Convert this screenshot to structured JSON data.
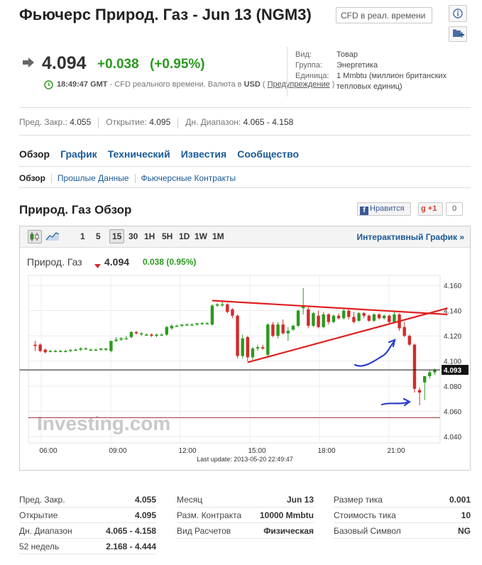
{
  "header": {
    "title": "Фьючерс Природ. Газ - Jun 13 (NGM3)",
    "cfd_placeholder": "CFD в реал. времени"
  },
  "quote": {
    "price": "4.094",
    "change": "+0.038",
    "change_pct": "(+0.95%)",
    "time": "18:49:47 GMT",
    "desc": " - CFD реального времени. Валюта в ",
    "currency": "USD",
    "paren_open": " ( ",
    "warning_link": "Предупреждение",
    "paren_close": " )"
  },
  "facts": [
    {
      "label": "Вид:",
      "value": "Товар"
    },
    {
      "label": "Группа:",
      "value": "Энергетика"
    },
    {
      "label": "Единица:",
      "value": "1 Mmbtu (миллион британских"
    },
    {
      "label": "",
      "value": "тепловых единиц)"
    }
  ],
  "stats": [
    {
      "label": "Пред. Закр.:",
      "value": "4.055"
    },
    {
      "label": "Открытие:",
      "value": "4.095"
    },
    {
      "label": "Дн. Диапазон:",
      "value": "4.065 - 4.158"
    }
  ],
  "tabs": [
    "Обзор",
    "График",
    "Технический",
    "Известия",
    "Сообщество"
  ],
  "subtabs": [
    "Обзор",
    "Прошлые Данные",
    "Фьючерсные Контракты"
  ],
  "section": {
    "title": "Природ. Газ Обзор",
    "like_label": "Нравится",
    "gplus_label": "+1",
    "gplus_count": "0"
  },
  "chart_toolbar": {
    "timeframes": [
      "1",
      "5",
      "15",
      "30",
      "1H",
      "5H",
      "1D",
      "1W",
      "1M"
    ],
    "selected": "15",
    "interactive_label": "Интерактивный График »"
  },
  "chart_header": {
    "name": "Природ. Газ",
    "price": "4.094",
    "change": "0.038 (0.95%)"
  },
  "chart_data": {
    "type": "candlestick",
    "x_ticks": [
      "06:00",
      "09:00",
      "12:00",
      "15:00",
      "18:00",
      "21:00"
    ],
    "y_ticks": [
      "4.160",
      "4.140",
      "4.120",
      "4.100",
      "4.080",
      "4.060",
      "4.040"
    ],
    "ylim": [
      4.035,
      4.168
    ],
    "current_price_label": "4.093",
    "current_price": 4.093,
    "prev_close": 4.055,
    "last_update": "Last update: 2013-05-20 22:49:47",
    "watermark": "Investing.com",
    "candles": [
      {
        "o": 4.113,
        "h": 4.116,
        "l": 4.108,
        "c": 4.112
      },
      {
        "o": 4.113,
        "h": 4.114,
        "l": 4.107,
        "c": 4.108
      },
      {
        "o": 4.109,
        "h": 4.11,
        "l": 4.106,
        "c": 4.107
      },
      {
        "o": 4.108,
        "h": 4.109,
        "l": 4.107,
        "c": 4.108
      },
      {
        "o": 4.108,
        "h": 4.109,
        "l": 4.107,
        "c": 4.108
      },
      {
        "o": 4.108,
        "h": 4.109,
        "l": 4.107,
        "c": 4.108
      },
      {
        "o": 4.108,
        "h": 4.109,
        "l": 4.107,
        "c": 4.108
      },
      {
        "o": 4.108,
        "h": 4.109,
        "l": 4.107,
        "c": 4.109
      },
      {
        "o": 4.109,
        "h": 4.11,
        "l": 4.108,
        "c": 4.109
      },
      {
        "o": 4.109,
        "h": 4.111,
        "l": 4.108,
        "c": 4.11
      },
      {
        "o": 4.11,
        "h": 4.111,
        "l": 4.109,
        "c": 4.11
      },
      {
        "o": 4.109,
        "h": 4.11,
        "l": 4.108,
        "c": 4.109
      },
      {
        "o": 4.109,
        "h": 4.11,
        "l": 4.108,
        "c": 4.109
      },
      {
        "o": 4.109,
        "h": 4.11,
        "l": 4.108,
        "c": 4.11
      },
      {
        "o": 4.109,
        "h": 4.11,
        "l": 4.108,
        "c": 4.11
      },
      {
        "o": 4.108,
        "h": 4.116,
        "l": 4.107,
        "c": 4.116
      },
      {
        "o": 4.116,
        "h": 4.119,
        "l": 4.115,
        "c": 4.117
      },
      {
        "o": 4.117,
        "h": 4.119,
        "l": 4.116,
        "c": 4.118
      },
      {
        "o": 4.118,
        "h": 4.12,
        "l": 4.117,
        "c": 4.118
      },
      {
        "o": 4.119,
        "h": 4.124,
        "l": 4.118,
        "c": 4.123
      },
      {
        "o": 4.123,
        "h": 4.124,
        "l": 4.121,
        "c": 4.122
      },
      {
        "o": 4.122,
        "h": 4.123,
        "l": 4.12,
        "c": 4.122
      },
      {
        "o": 4.121,
        "h": 4.122,
        "l": 4.12,
        "c": 4.121
      },
      {
        "o": 4.121,
        "h": 4.122,
        "l": 4.119,
        "c": 4.12
      },
      {
        "o": 4.12,
        "h": 4.122,
        "l": 4.119,
        "c": 4.121
      },
      {
        "o": 4.121,
        "h": 4.122,
        "l": 4.12,
        "c": 4.121
      },
      {
        "o": 4.121,
        "h": 4.128,
        "l": 4.12,
        "c": 4.127
      },
      {
        "o": 4.126,
        "h": 4.129,
        "l": 4.125,
        "c": 4.128
      },
      {
        "o": 4.128,
        "h": 4.129,
        "l": 4.127,
        "c": 4.128
      },
      {
        "o": 4.128,
        "h": 4.129,
        "l": 4.127,
        "c": 4.129
      },
      {
        "o": 4.129,
        "h": 4.13,
        "l": 4.128,
        "c": 4.129
      },
      {
        "o": 4.129,
        "h": 4.13,
        "l": 4.128,
        "c": 4.129
      },
      {
        "o": 4.129,
        "h": 4.13,
        "l": 4.128,
        "c": 4.13
      },
      {
        "o": 4.13,
        "h": 4.131,
        "l": 4.129,
        "c": 4.13
      },
      {
        "o": 4.13,
        "h": 4.131,
        "l": 4.129,
        "c": 4.13
      },
      {
        "o": 4.129,
        "h": 4.145,
        "l": 4.128,
        "c": 4.144
      },
      {
        "o": 4.144,
        "h": 4.146,
        "l": 4.143,
        "c": 4.145
      },
      {
        "o": 4.145,
        "h": 4.147,
        "l": 4.143,
        "c": 4.145
      },
      {
        "o": 4.145,
        "h": 4.146,
        "l": 4.138,
        "c": 4.139
      },
      {
        "o": 4.141,
        "h": 4.142,
        "l": 4.134,
        "c": 4.136
      },
      {
        "o": 4.136,
        "h": 4.137,
        "l": 4.102,
        "c": 4.104
      },
      {
        "o": 4.104,
        "h": 4.121,
        "l": 4.102,
        "c": 4.118
      },
      {
        "o": 4.119,
        "h": 4.12,
        "l": 4.1,
        "c": 4.103
      },
      {
        "o": 4.103,
        "h": 4.111,
        "l": 4.101,
        "c": 4.11
      },
      {
        "o": 4.11,
        "h": 4.113,
        "l": 4.108,
        "c": 4.111
      },
      {
        "o": 4.111,
        "h": 4.113,
        "l": 4.109,
        "c": 4.11
      },
      {
        "o": 4.105,
        "h": 4.13,
        "l": 4.104,
        "c": 4.129
      },
      {
        "o": 4.129,
        "h": 4.131,
        "l": 4.119,
        "c": 4.12
      },
      {
        "o": 4.12,
        "h": 4.131,
        "l": 4.118,
        "c": 4.129
      },
      {
        "o": 4.129,
        "h": 4.133,
        "l": 4.121,
        "c": 4.122
      },
      {
        "o": 4.122,
        "h": 4.127,
        "l": 4.116,
        "c": 4.124
      },
      {
        "o": 4.125,
        "h": 4.129,
        "l": 4.124,
        "c": 4.128
      },
      {
        "o": 4.128,
        "h": 4.141,
        "l": 4.127,
        "c": 4.14
      },
      {
        "o": 4.142,
        "h": 4.158,
        "l": 4.137,
        "c": 4.144
      },
      {
        "o": 4.141,
        "h": 4.144,
        "l": 4.126,
        "c": 4.128
      },
      {
        "o": 4.128,
        "h": 4.139,
        "l": 4.127,
        "c": 4.138
      },
      {
        "o": 4.136,
        "h": 4.14,
        "l": 4.126,
        "c": 4.127
      },
      {
        "o": 4.127,
        "h": 4.139,
        "l": 4.126,
        "c": 4.137
      },
      {
        "o": 4.137,
        "h": 4.138,
        "l": 4.129,
        "c": 4.131
      },
      {
        "o": 4.131,
        "h": 4.137,
        "l": 4.13,
        "c": 4.136
      },
      {
        "o": 4.136,
        "h": 4.138,
        "l": 4.133,
        "c": 4.134
      },
      {
        "o": 4.134,
        "h": 4.141,
        "l": 4.133,
        "c": 4.14
      },
      {
        "o": 4.14,
        "h": 4.141,
        "l": 4.133,
        "c": 4.135
      },
      {
        "o": 4.135,
        "h": 4.139,
        "l": 4.13,
        "c": 4.131
      },
      {
        "o": 4.132,
        "h": 4.139,
        "l": 4.131,
        "c": 4.138
      },
      {
        "o": 4.138,
        "h": 4.139,
        "l": 4.134,
        "c": 4.136
      },
      {
        "o": 4.136,
        "h": 4.137,
        "l": 4.131,
        "c": 4.132
      },
      {
        "o": 4.132,
        "h": 4.138,
        "l": 4.131,
        "c": 4.137
      },
      {
        "o": 4.137,
        "h": 4.138,
        "l": 4.133,
        "c": 4.134
      },
      {
        "o": 4.134,
        "h": 4.137,
        "l": 4.133,
        "c": 4.136
      },
      {
        "o": 4.136,
        "h": 4.137,
        "l": 4.13,
        "c": 4.131
      },
      {
        "o": 4.131,
        "h": 4.139,
        "l": 4.13,
        "c": 4.137
      },
      {
        "o": 4.137,
        "h": 4.138,
        "l": 4.124,
        "c": 4.126
      },
      {
        "o": 4.127,
        "h": 4.131,
        "l": 4.119,
        "c": 4.12
      },
      {
        "o": 4.12,
        "h": 4.121,
        "l": 4.112,
        "c": 4.113
      },
      {
        "o": 4.113,
        "h": 4.114,
        "l": 4.075,
        "c": 4.078
      },
      {
        "o": 4.077,
        "h": 4.079,
        "l": 4.065,
        "c": 4.075
      },
      {
        "o": 4.083,
        "h": 4.088,
        "l": 4.069,
        "c": 4.088
      },
      {
        "o": 4.088,
        "h": 4.093,
        "l": 4.086,
        "c": 4.091
      },
      {
        "o": 4.091,
        "h": 4.094,
        "l": 4.089,
        "c": 4.093
      }
    ],
    "annotations": [
      {
        "type": "trendline",
        "color": "#e02020",
        "from": {
          "x_index": 35,
          "y": 4.148
        },
        "to": {
          "x_index": 79,
          "y": 4.137
        }
      },
      {
        "type": "trendline",
        "color": "#e02020",
        "from": {
          "x_index": 42,
          "y": 4.099
        },
        "to": {
          "x_index": 79,
          "y": 4.142
        }
      },
      {
        "type": "freehand",
        "color": "#2c3fc9"
      },
      {
        "type": "freehand",
        "color": "#2c3fc9"
      }
    ]
  },
  "bottom": {
    "col1": [
      {
        "label": "Пред. Закр.",
        "value": "4.055"
      },
      {
        "label": "Открытие",
        "value": "4.095"
      },
      {
        "label": "Дн. Диапазон",
        "value": "4.065 - 4.158"
      },
      {
        "label": "52 недель",
        "value": "2.168 - 4.444"
      }
    ],
    "col2": [
      {
        "label": "Месяц",
        "value": "Jun 13"
      },
      {
        "label": "Разм. Контракта",
        "value": "10000 Mmbtu"
      },
      {
        "label": "Вид Расчетов",
        "value": "Физическая"
      }
    ],
    "col3": [
      {
        "label": "Размер тика",
        "value": "0.001"
      },
      {
        "label": "Стоимость тика",
        "value": "10"
      },
      {
        "label": "Базовый Символ",
        "value": "NG"
      }
    ]
  },
  "colors": {
    "link": "#1a5a96",
    "up": "#2b9a1f",
    "down": "#d22b2b",
    "accent_red": "#e02020",
    "annotation_blue": "#2c3fc9"
  }
}
